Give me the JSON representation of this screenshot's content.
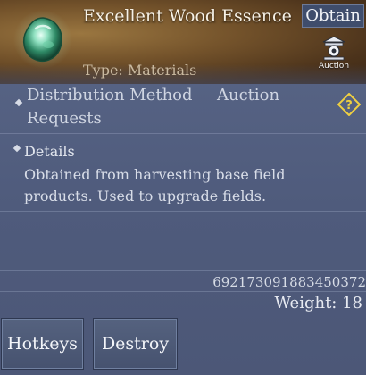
{
  "item": {
    "name": "Excellent Wood Essence",
    "type_label": "Type: Materials",
    "icon": "green-wood-essence-gem-icon"
  },
  "header_actions": {
    "obtain_label": "Obtain",
    "auction_label": "Auction",
    "auction_icon": "auction-house-icon"
  },
  "distribution": {
    "label_line1": "Distribution Method",
    "value": "Auction",
    "label_line2": "Requests",
    "help_icon": "question-mark-icon"
  },
  "details": {
    "title": "Details",
    "text": "Obtained from harvesting base field products. Used to upgrade fields."
  },
  "footer": {
    "item_id": "6921730918834503​72",
    "weight": "Weight: 18"
  },
  "buttons": {
    "hotkeys_label": "Hotkeys",
    "destroy_label": "Destroy"
  },
  "colors": {
    "panel_bg": "#55617f",
    "header_bg": "#74532b",
    "type_text": "#c9b9a0",
    "help_icon": "#f0d040"
  }
}
